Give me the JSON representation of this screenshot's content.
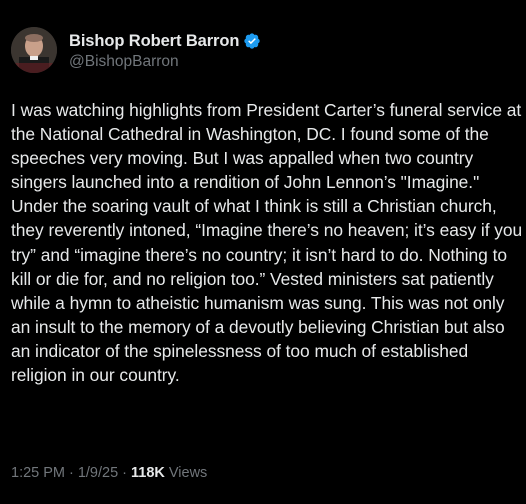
{
  "header": {
    "display_name": "Bishop Robert Barron",
    "handle": "@BishopBarron",
    "verified_icon": "verified-badge-icon",
    "avatar_icon": "avatar-photo"
  },
  "tweet": {
    "text": "I was watching highlights from President Carter’s funeral service at the National Cathedral in Washington, DC. I found some of the speeches very moving. But I was appalled when two country singers launched into a rendition of John Lennon’s \"Imagine.\"  Under the soaring vault of what I think is still a Christian church, they reverently intoned, “Imagine there’s no heaven; it’s easy if you try” and “imagine there’s no country; it isn’t hard to do. Nothing to kill or die for, and no religion too.” Vested ministers sat patiently while a hymn to atheistic humanism was sung. This was not only an insult to the memory of a devoutly believing Christian but also an indicator of the spinelessness of too much of established religion in our country."
  },
  "meta": {
    "time": "1:25 PM",
    "date": "1/9/25",
    "views_count": "118K",
    "views_label": "Views"
  },
  "colors": {
    "background": "#000000",
    "text": "#e7e9ea",
    "secondary": "#71767b",
    "verified": "#1d9bf0"
  }
}
